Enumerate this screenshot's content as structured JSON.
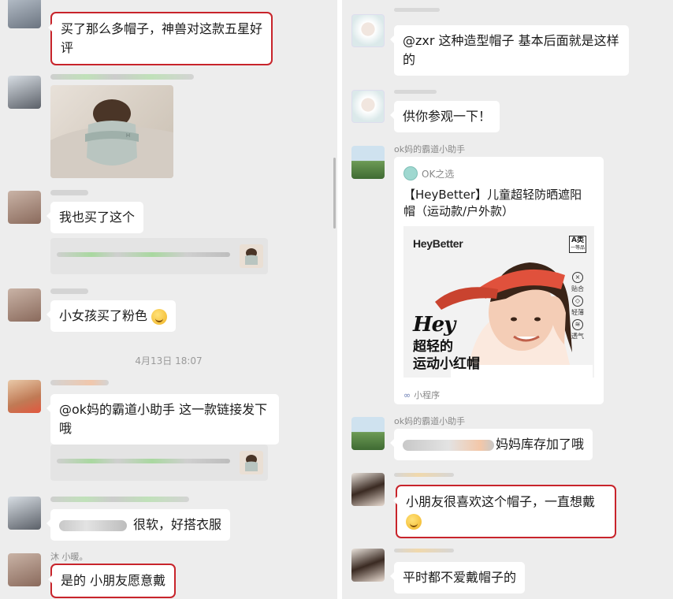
{
  "left": {
    "timestamp": "4月13日 18:07",
    "messages": [
      {
        "text": "买了那么多帽子，神兽对这款五星好评"
      },
      {
        "text": "我也买了这个"
      },
      {
        "text": "小女孩买了粉色"
      },
      {
        "text": "@ok妈的霸道小助手 这一款链接发下哦"
      },
      {
        "text": "很软，好搭衣服"
      },
      {
        "sender": "沐 小暖。",
        "text": "是的 小朋友愿意戴"
      }
    ]
  },
  "right": {
    "messages": [
      {
        "text": "@zxr 这种造型帽子 基本后面就是这样的"
      },
      {
        "text": "供你参观一下！"
      },
      {
        "sender": "ok妈的霸道小助手"
      },
      {
        "sender": "ok妈的霸道小助手",
        "text": "妈妈库存加了哦"
      },
      {
        "text": "小朋友很喜欢这个帽子，一直想戴"
      },
      {
        "text": "平时都不爱戴帽子的"
      }
    ],
    "mini_program": {
      "source": "OK之选",
      "title": "【HeyBetter】儿童超轻防晒遮阳帽（运动款/户外款）",
      "brand": "HeyBetter",
      "grade_badge": "A类",
      "grade_badge_sub": "一等品",
      "features": [
        "贴合",
        "轻薄",
        "透气"
      ],
      "slogan_script": "Hey",
      "slogan_line1": "超轻的",
      "slogan_line2": "运动小红帽",
      "footer": "小程序"
    }
  },
  "colors": {
    "background": "#ededed",
    "bubble": "#ffffff",
    "highlight_box": "#c8242b",
    "cap_red": "#e0513c"
  }
}
